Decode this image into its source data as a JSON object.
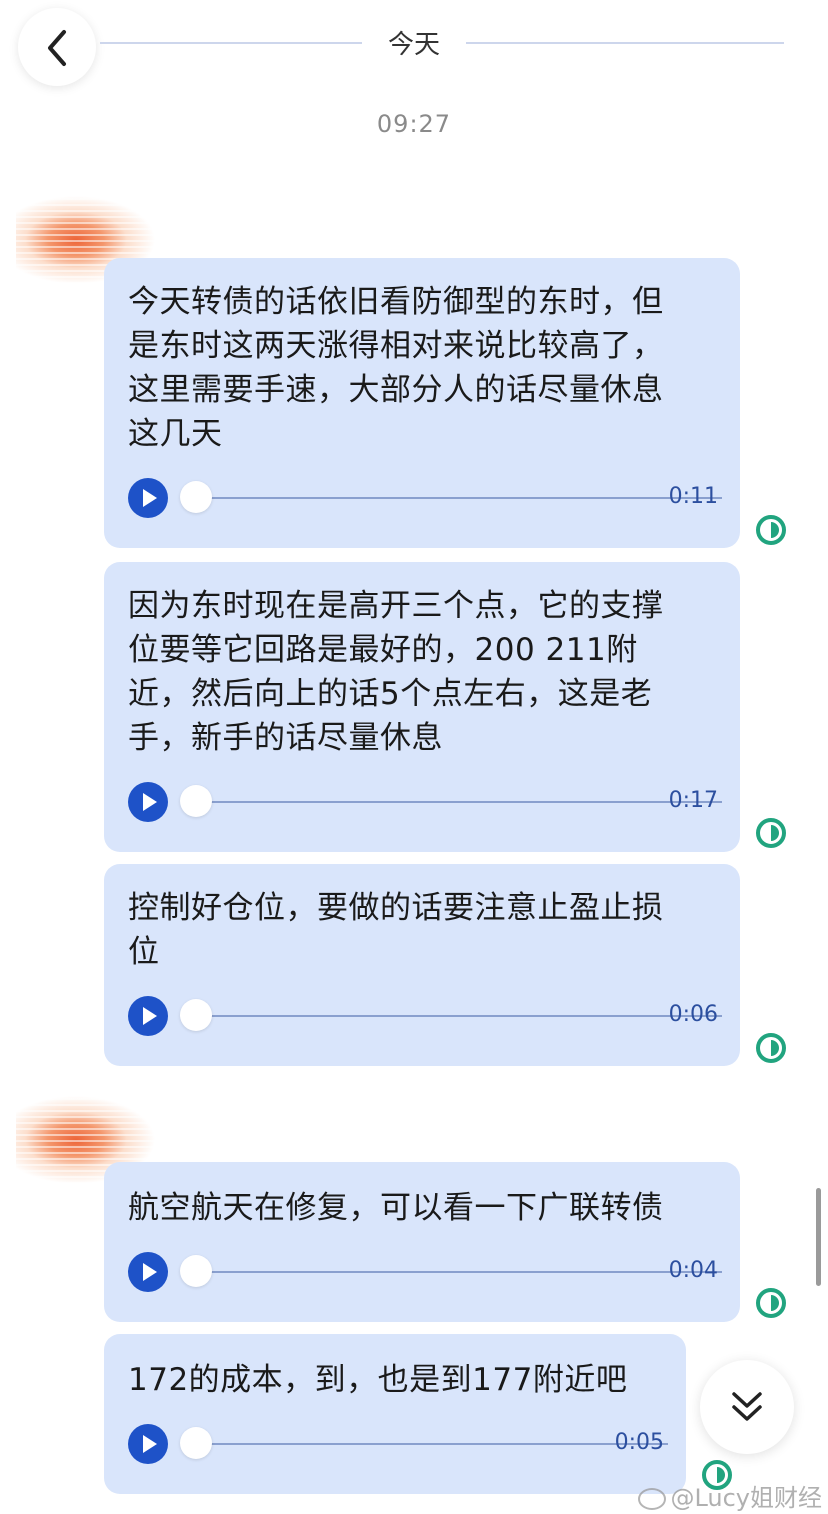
{
  "header": {
    "day_label": "今天"
  },
  "timestamp": "09:27",
  "groups": [
    {
      "messages": [
        {
          "text": "今天转债的话依旧看防御型的东时，但\n是东时这两天涨得相对来说比较高了，\n这里需要手速，大部分人的话尽量休息\n这几天",
          "duration": "0:11"
        },
        {
          "text": "因为东时现在是高开三个点，它的支撑\n位要等它回路是最好的，200 211附\n近，然后向上的话5个点左右，这是老\n手，新手的话尽量休息",
          "duration": "0:17"
        },
        {
          "text": "控制好仓位，要做的话要注意止盈止损\n位",
          "duration": "0:06"
        }
      ]
    },
    {
      "messages": [
        {
          "text": "航空航天在修复，可以看一下广联转债",
          "duration": "0:04"
        },
        {
          "text": "172的成本，到，也是到177附近吧",
          "duration": "0:05"
        }
      ]
    }
  ],
  "watermark": "@Lucy姐财经",
  "colors": {
    "bubble": "#d9e5fb",
    "play": "#1e52c8",
    "status": "#21a47f"
  }
}
